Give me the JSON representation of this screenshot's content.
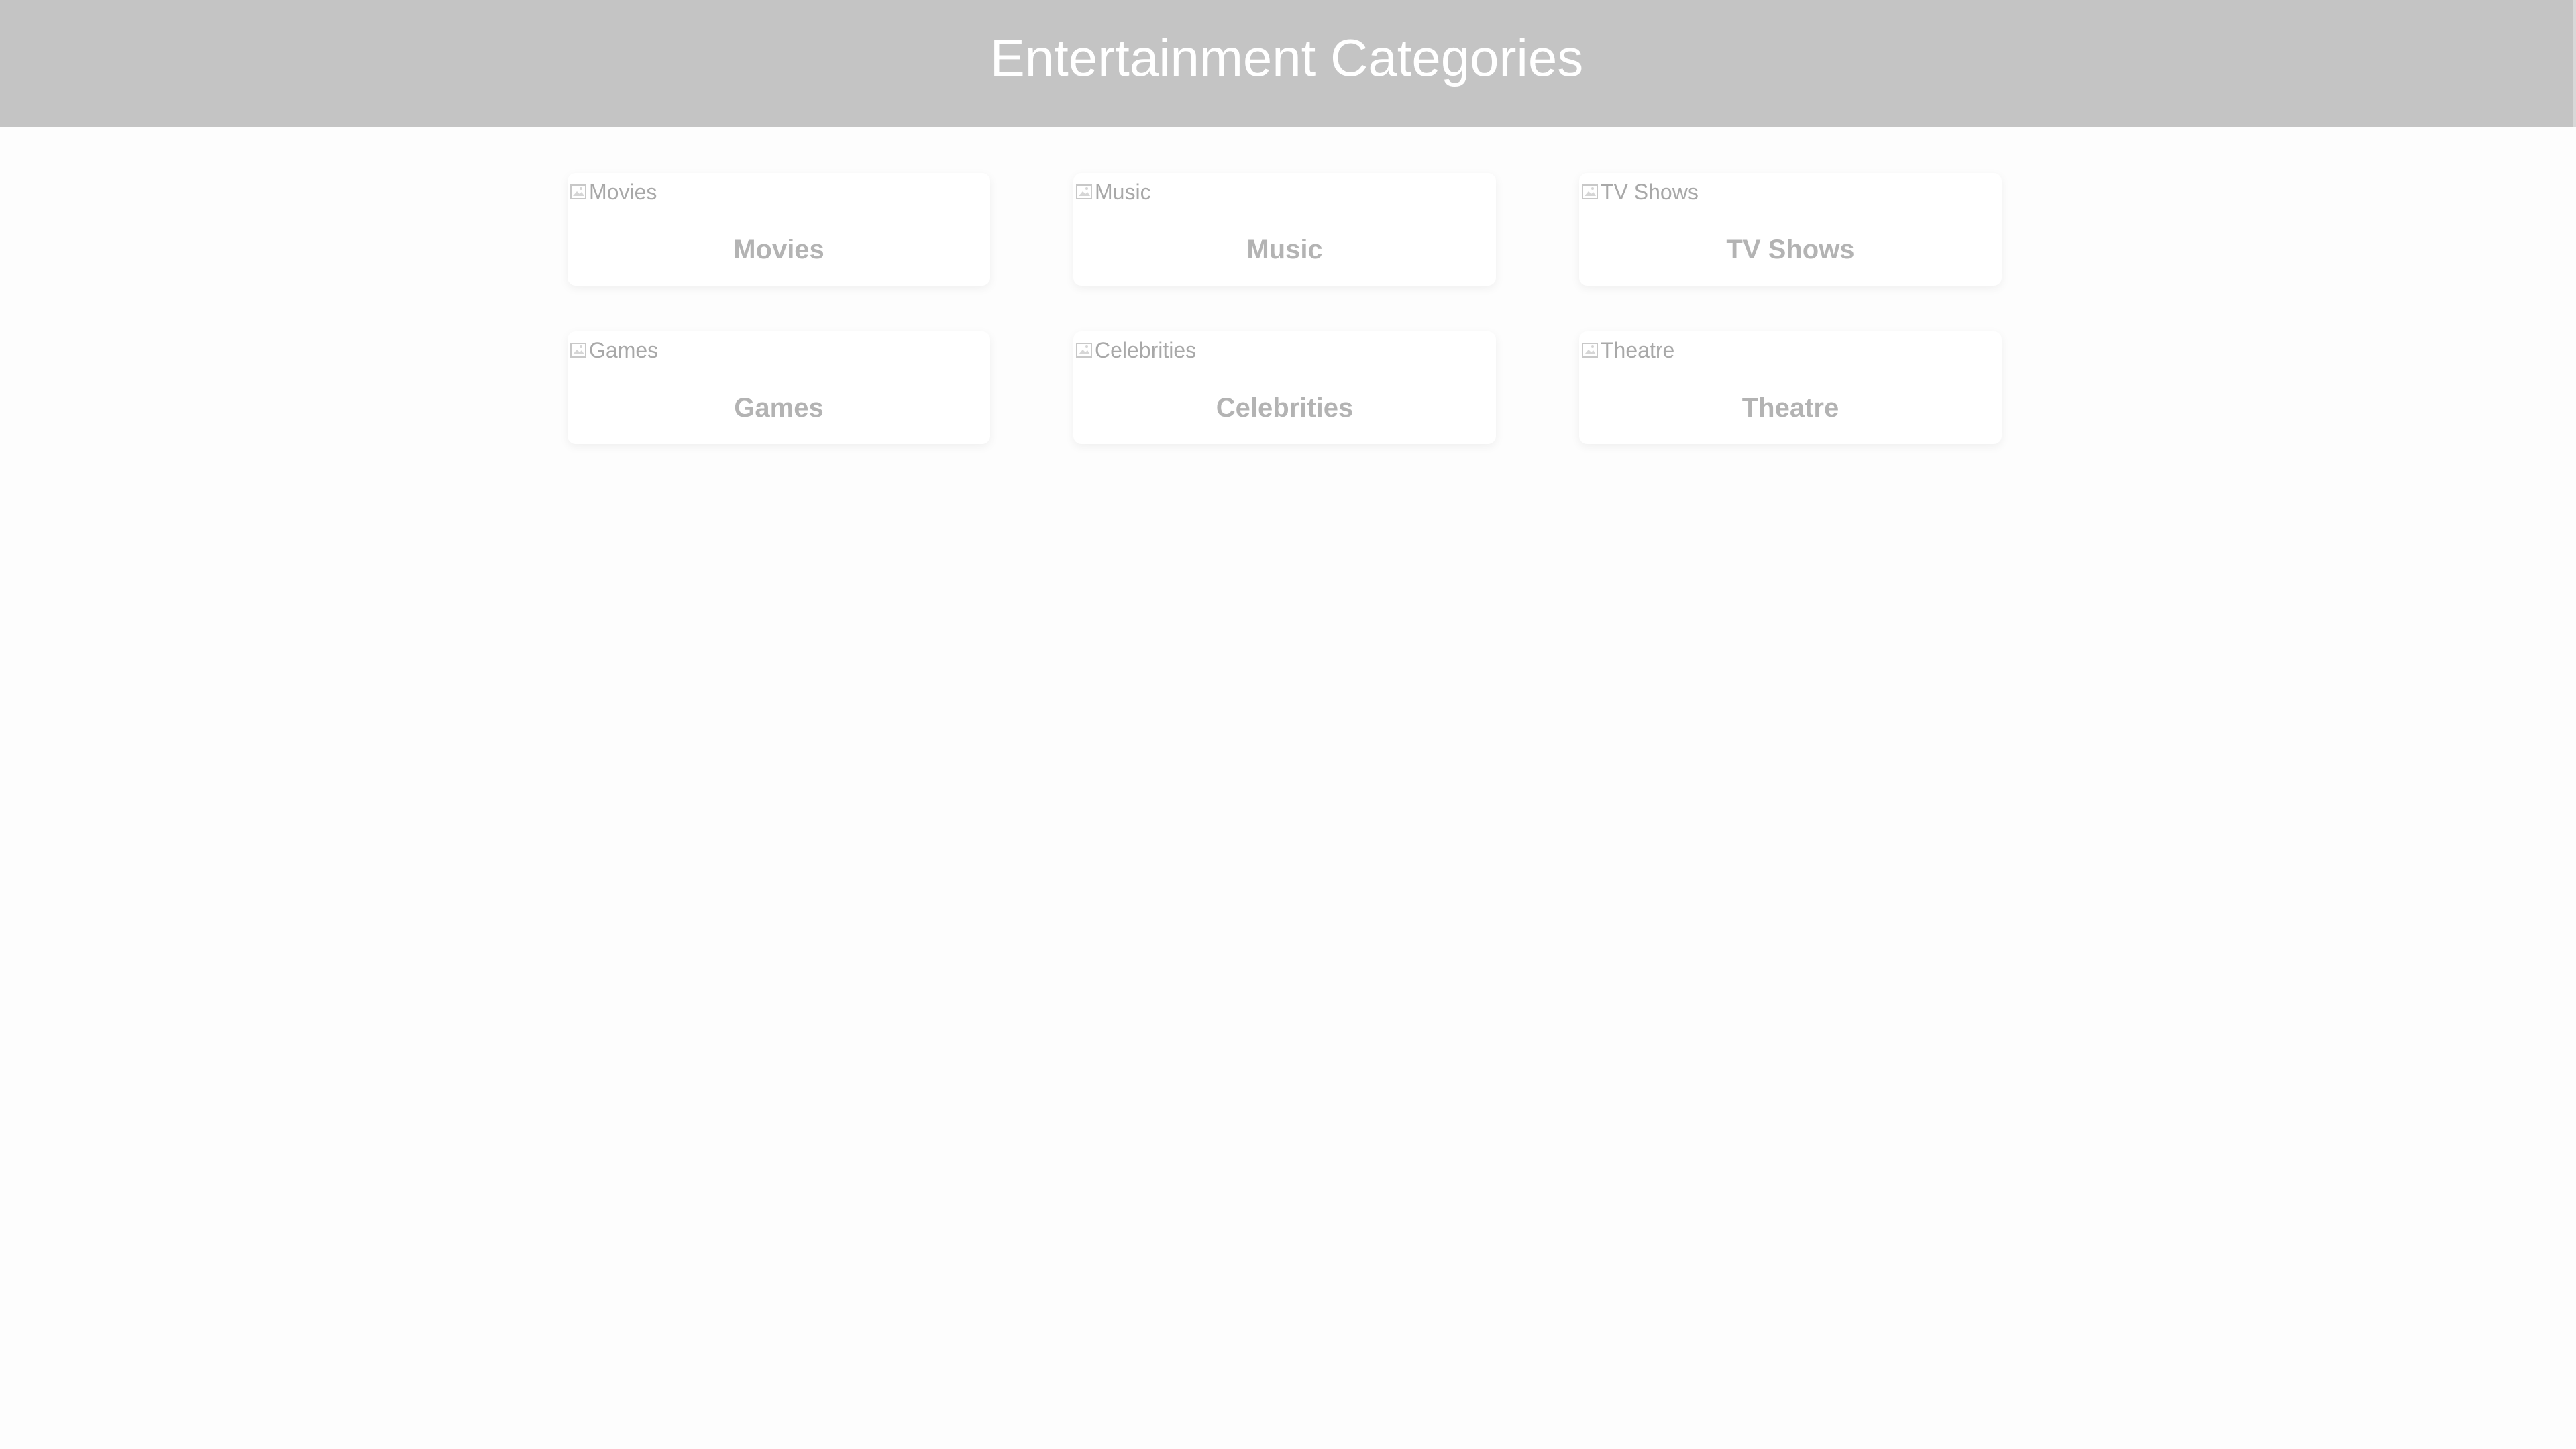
{
  "header": {
    "title": "Entertainment Categories",
    "background": "#c4c4c4",
    "text_color": "#ffffff"
  },
  "categories": [
    {
      "alt": "Movies",
      "name": "Movies",
      "icon": "broken-image-icon"
    },
    {
      "alt": "Music",
      "name": "Music",
      "icon": "broken-image-icon"
    },
    {
      "alt": "TV Shows",
      "name": "TV Shows",
      "icon": "broken-image-icon"
    },
    {
      "alt": "Games",
      "name": "Games",
      "icon": "broken-image-icon"
    },
    {
      "alt": "Celebrities",
      "name": "Celebrities",
      "icon": "broken-image-icon"
    },
    {
      "alt": "Theatre",
      "name": "Theatre",
      "icon": "broken-image-icon"
    }
  ]
}
